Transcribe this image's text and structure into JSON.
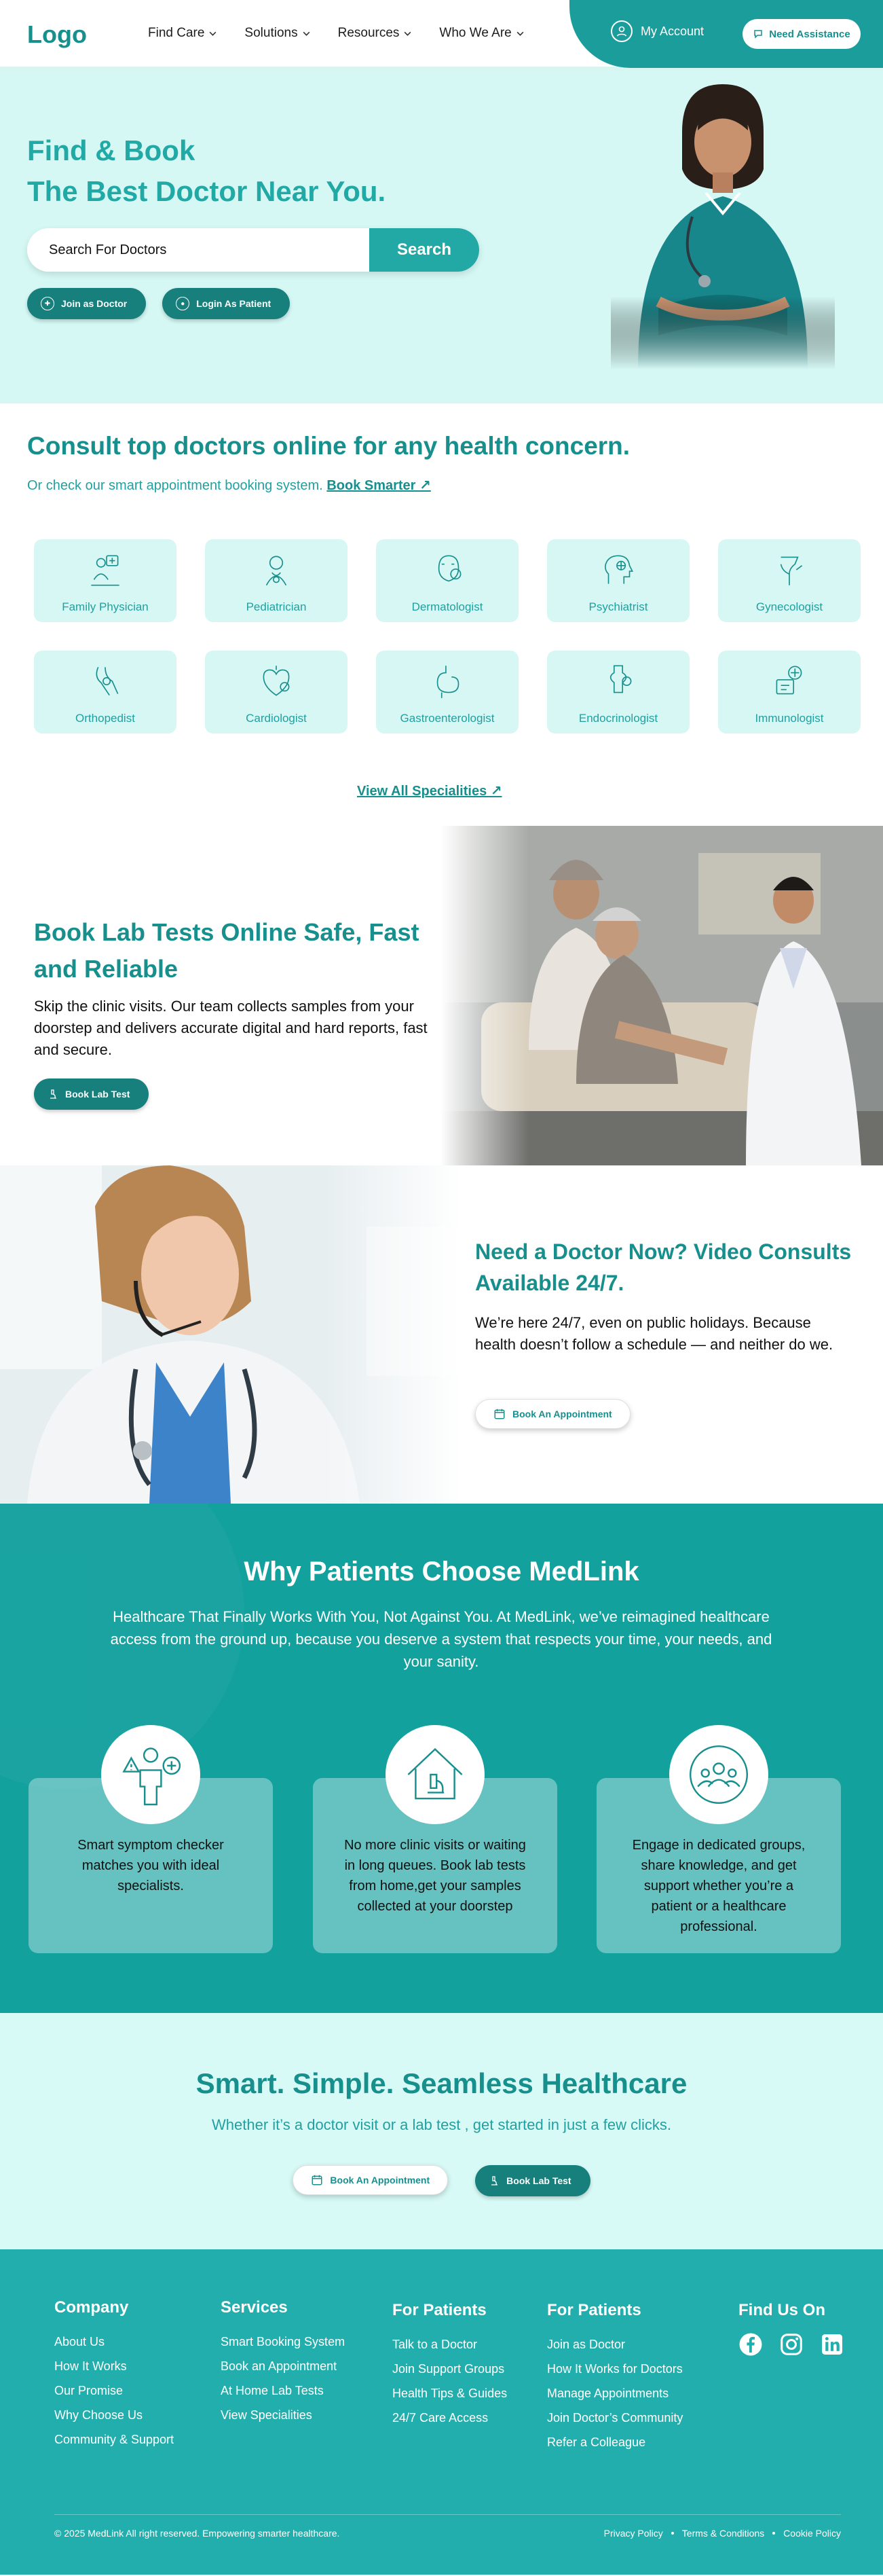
{
  "header": {
    "logo": "Logo",
    "nav": [
      {
        "label": "Find Care"
      },
      {
        "label": "Solutions"
      },
      {
        "label": "Resources"
      },
      {
        "label": "Who We Are"
      }
    ],
    "account_label": "My Account",
    "assist_label": "Need Assistance"
  },
  "hero": {
    "title_line1": "Find & Book",
    "title_line2": "The Best Doctor Near You.",
    "search_value": "Search For Doctors",
    "search_button": "Search",
    "join_doctor": "Join as Doctor",
    "login_patient": "Login As Patient"
  },
  "specialities": {
    "title": "Consult top doctors online for any health concern.",
    "subtitle": "Or check our smart appointment booking system.",
    "link_label": "Book Smarter ↗",
    "items": [
      {
        "label": "Family Physician",
        "icon": "family-physician-icon"
      },
      {
        "label": "Pediatrician",
        "icon": "pediatrician-icon"
      },
      {
        "label": "Dermatologist",
        "icon": "dermatologist-icon"
      },
      {
        "label": "Psychiatrist",
        "icon": "psychiatrist-icon"
      },
      {
        "label": "Gynecologist",
        "icon": "gynecologist-icon"
      },
      {
        "label": "Orthopedist",
        "icon": "orthopedist-icon"
      },
      {
        "label": "Cardiologist",
        "icon": "cardiologist-icon"
      },
      {
        "label": "Gastroenterologist",
        "icon": "gastroenterologist-icon"
      },
      {
        "label": "Endocrinologist",
        "icon": "endocrinologist-icon"
      },
      {
        "label": "Immunologist",
        "icon": "immunologist-icon"
      }
    ],
    "view_all": "View All Specialities ↗"
  },
  "lab": {
    "title": "Book Lab Tests Online Safe, Fast and Reliable",
    "body": "Skip the clinic visits. Our team collects samples from your doorstep and delivers accurate digital and hard reports, fast and secure.",
    "button": "Book Lab Test"
  },
  "video": {
    "title": "Need a Doctor Now? Video Consults Available 24/7.",
    "body": "We’re here 24/7, even on public holidays. Because health doesn’t follow a schedule — and neither do we.",
    "button": "Book An Appointment"
  },
  "why": {
    "title": "Why Patients Choose MedLink",
    "subtitle": "Healthcare That Finally Works With You, Not Against You. At MedLink, we’ve reimagined healthcare access from the ground up, because you deserve a system that respects your time, your needs, and your sanity.",
    "cards": [
      {
        "text": "Smart symptom checker matches you with ideal specialists."
      },
      {
        "text": "No more clinic visits or waiting in long queues. Book lab tests from home,get your samples collected at your doorstep"
      },
      {
        "text": "Engage in dedicated groups, share knowledge, and get support whether you’re a patient or a healthcare professional."
      }
    ]
  },
  "cta": {
    "title": "Smart. Simple. Seamless Healthcare",
    "subtitle": "Whether it’s a doctor visit or a lab test , get started in just a few clicks.",
    "appointment": "Book An Appointment",
    "lab": "Book Lab Test"
  },
  "footer": {
    "company": {
      "title": "Company",
      "links": [
        "About Us",
        "How It Works",
        "Our Promise",
        "Why Choose Us",
        "Community & Support"
      ]
    },
    "services": {
      "title": "Services",
      "links": [
        "Smart Booking System",
        "Book an Appointment",
        "At Home Lab Tests",
        "View Specialities"
      ]
    },
    "patients1": {
      "title": "For Patients",
      "links": [
        "Talk to a Doctor",
        "Join Support Groups",
        "Health Tips & Guides",
        "24/7 Care Access"
      ]
    },
    "patients2": {
      "title": "For Patients",
      "links": [
        "Join as Doctor",
        "How It Works for Doctors",
        "Manage Appointments",
        "Join Doctor’s Community",
        "Refer a Colleague"
      ]
    },
    "find_us": "Find Us On",
    "copyright": "© 2025 MedLink All right reserved. Empowering smarter healthcare.",
    "legal": [
      "Privacy Policy",
      "Terms & Conditions",
      "Cookie Policy"
    ]
  },
  "colors": {
    "primary": "#178f8d",
    "accent": "#22a9a5",
    "mint": "#d5f8f4",
    "teal_section": "#13a19e",
    "footer": "#22aeac"
  }
}
